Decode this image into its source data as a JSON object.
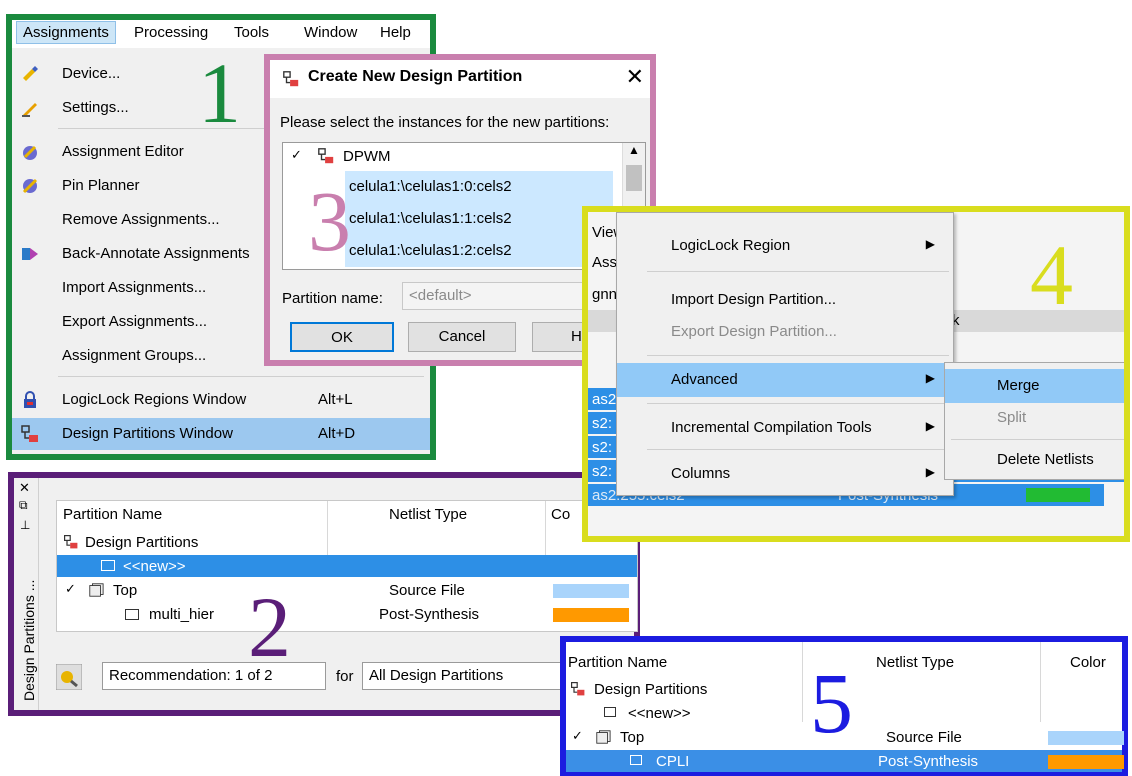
{
  "panel1": {
    "number": "1",
    "menubar": [
      "Assignments",
      "Processing",
      "Tools",
      "Window",
      "Help"
    ],
    "items": [
      {
        "label": "Device...",
        "shortcut": "",
        "icon": "device-chip-icon"
      },
      {
        "label": "Settings...",
        "shortcut": "",
        "icon": "settings-pencil-icon"
      },
      {
        "label": "Assignment Editor",
        "shortcut": "",
        "icon": "assignment-editor-icon"
      },
      {
        "label": "Pin Planner",
        "shortcut": "",
        "icon": "pin-planner-icon"
      },
      {
        "label": "Remove Assignments...",
        "shortcut": "",
        "icon": ""
      },
      {
        "label": "Back-Annotate Assignments",
        "shortcut": "",
        "icon": "back-annotate-icon"
      },
      {
        "label": "Import Assignments...",
        "shortcut": "",
        "icon": ""
      },
      {
        "label": "Export Assignments...",
        "shortcut": "",
        "icon": ""
      },
      {
        "label": "Assignment Groups...",
        "shortcut": "",
        "icon": ""
      },
      {
        "label": "LogicLock Regions Window",
        "shortcut": "Alt+L",
        "icon": "logiclock-icon"
      },
      {
        "label": "Design Partitions Window",
        "shortcut": "Alt+D",
        "icon": "partition-icon"
      }
    ]
  },
  "panel2": {
    "number": "2",
    "sidebar_label": "Design Partitions ...",
    "headers": [
      "Partition Name",
      "Netlist Type",
      "Co"
    ],
    "rows": [
      {
        "name": "Design Partitions",
        "netlist": "",
        "color": ""
      },
      {
        "name": "<<new>>",
        "netlist": "",
        "color": ""
      },
      {
        "name": "Top",
        "netlist": "Source File",
        "color": "#a9d4fb"
      },
      {
        "name": "multi_hier",
        "netlist": "Post-Synthesis",
        "color": "#ff9900"
      }
    ],
    "recommendation": "Recommendation: 1 of 2",
    "for_label": "for",
    "scope_value": "All Design Partitions"
  },
  "panel3": {
    "number": "3",
    "title": "Create New Design Partition",
    "prompt": "Please select the instances for the new partitions:",
    "root": "DPWM",
    "instances": [
      "celula1:\\celulas1:0:cels2",
      "celula1:\\celulas1:1:cels2",
      "celula1:\\celulas1:2:cels2"
    ],
    "partition_label": "Partition name:",
    "partition_placeholder": "<default>",
    "ok": "OK",
    "cancel": "Cancel",
    "help": "H"
  },
  "panel4": {
    "number": "4",
    "bg_fragments": [
      "View",
      "Assi",
      "gnn",
      "k",
      "as2:",
      "s2:",
      "s2:",
      "s2:"
    ],
    "bg_last_row": [
      "as2:255:cels2",
      "Post-Synthesis"
    ],
    "bg_last_color": "#22bb33",
    "items": [
      {
        "label": "LogicLock Region",
        "arrow": true,
        "disabled": false
      },
      {
        "label": "Import Design Partition...",
        "arrow": false,
        "disabled": false
      },
      {
        "label": "Export Design Partition...",
        "arrow": false,
        "disabled": true
      },
      {
        "label": "Advanced",
        "arrow": true,
        "disabled": false
      },
      {
        "label": "Incremental Compilation Tools",
        "arrow": true,
        "disabled": false
      },
      {
        "label": "Columns",
        "arrow": true,
        "disabled": false
      }
    ],
    "submenu": [
      {
        "label": "Merge",
        "disabled": false
      },
      {
        "label": "Split",
        "disabled": true
      },
      {
        "label": "Delete Netlists",
        "disabled": false
      }
    ]
  },
  "panel5": {
    "number": "5",
    "headers": [
      "Partition Name",
      "Netlist Type",
      "Color"
    ],
    "rows": [
      {
        "name": "Design Partitions",
        "netlist": "",
        "color": ""
      },
      {
        "name": "<<new>>",
        "netlist": "",
        "color": ""
      },
      {
        "name": "Top",
        "netlist": "Source File",
        "color": "#a9d4fb"
      },
      {
        "name": "CPLI",
        "netlist": "Post-Synthesis",
        "color": "#ff9900"
      }
    ]
  }
}
